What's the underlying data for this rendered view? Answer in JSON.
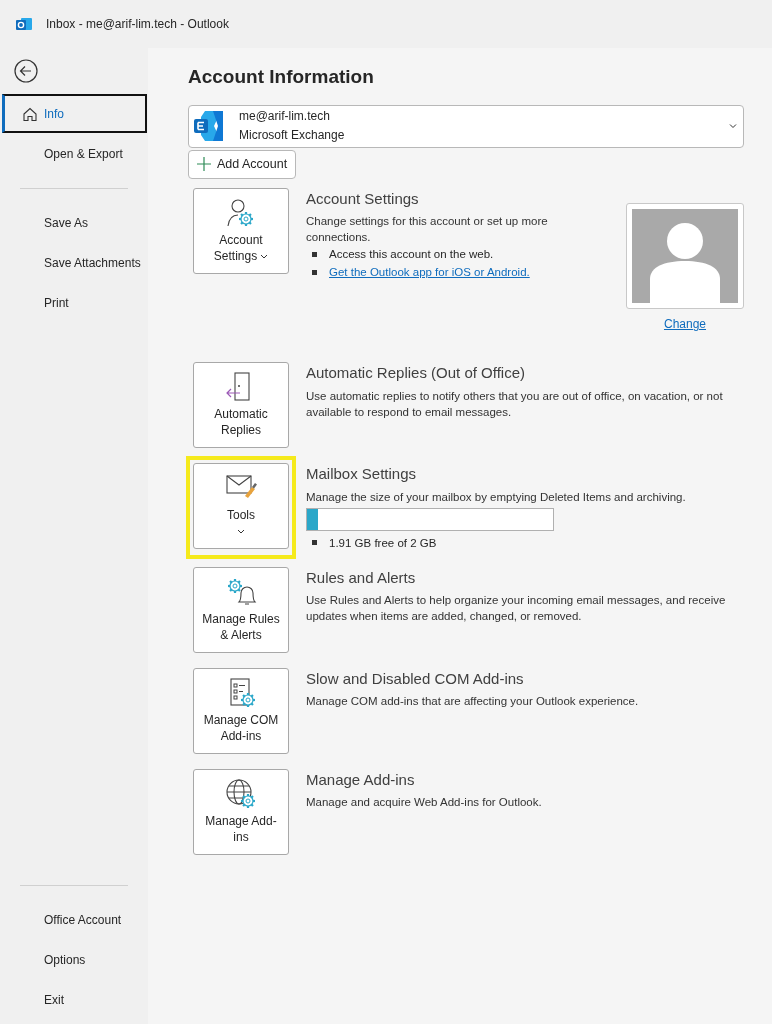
{
  "window": {
    "title": "Inbox -  me@arif-lim.tech  - Outlook"
  },
  "sidebar": {
    "groups": [
      [
        {
          "label": "Info",
          "selected": true
        },
        {
          "label": "Open & Export",
          "selected": false
        }
      ],
      [
        {
          "label": "Save As",
          "selected": false
        },
        {
          "label": "Save Attachments",
          "selected": false
        },
        {
          "label": "Print",
          "selected": false
        }
      ]
    ],
    "bottom_items": [
      {
        "label": "Office Account",
        "selected": false
      },
      {
        "label": "Options",
        "selected": false
      },
      {
        "label": "Exit",
        "selected": false
      }
    ]
  },
  "heading": "Account Information",
  "account": {
    "email": "me@arif-lim.tech",
    "type": "Microsoft Exchange"
  },
  "add_account": "Add Account",
  "sections": [
    {
      "kind": "account",
      "button": "Account Settings",
      "dropdown": true,
      "highlighted": false,
      "title": "Account Settings",
      "description": "Change settings for this account or set up more connections.",
      "bullets": [
        {
          "kind": "text",
          "text": "Access this account on the web."
        },
        {
          "kind": "link",
          "text": "Get the Outlook app for iOS or Android."
        }
      ],
      "photo_link": "Change"
    },
    {
      "kind": "plain",
      "button": "Automatic Replies",
      "dropdown": false,
      "highlighted": false,
      "title": "Automatic Replies (Out of Office)",
      "description": "Use automatic replies to notify others that you are out of office, on vacation, or not available to respond to email messages."
    },
    {
      "kind": "storage",
      "button": "Tools",
      "dropdown": true,
      "highlighted": true,
      "title": "Mailbox Settings",
      "description": "Manage the size of your mailbox by emptying Deleted Items and archiving.",
      "level": 0.045,
      "bullets": [
        {
          "kind": "text",
          "text": "1.91 GB free of 2 GB"
        }
      ]
    },
    {
      "kind": "plain",
      "button": "Manage Rules & Alerts",
      "dropdown": false,
      "highlighted": false,
      "title": "Rules and Alerts",
      "description": "Use Rules and Alerts to help organize your incoming email messages, and receive updates when items are added, changed, or removed."
    },
    {
      "kind": "plain",
      "button": "Manage COM Add-ins",
      "dropdown": false,
      "highlighted": false,
      "title": "Slow and Disabled COM Add-ins",
      "description": "Manage COM add-ins that are affecting your Outlook experience."
    },
    {
      "kind": "plain",
      "button": "Manage Add-ins",
      "dropdown": false,
      "highlighted": false,
      "title": "Manage Add-ins",
      "description": "Manage and acquire Web Add-ins for Outlook."
    }
  ]
}
